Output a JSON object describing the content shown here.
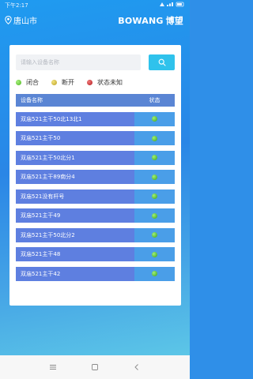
{
  "status_bar": {
    "time": "下午2:17"
  },
  "header": {
    "city": "唐山市",
    "brand_en": "BOWANG",
    "brand_cn": "博望"
  },
  "search": {
    "placeholder": "请输入设备名称"
  },
  "legend": [
    {
      "label": "闭合",
      "color": "#5fcf2e"
    },
    {
      "label": "断开",
      "color": "#d6c23a"
    },
    {
      "label": "状态未知",
      "color": "#c9232a"
    }
  ],
  "table": {
    "headers": {
      "name": "设备名称",
      "status": "状态"
    },
    "rows": [
      {
        "name": "双庙521主干50北13北1",
        "status": "闭合"
      },
      {
        "name": "双庙521主干50",
        "status": "闭合"
      },
      {
        "name": "双庙521主干50北分1",
        "status": "闭合"
      },
      {
        "name": "双庙521主干89南分4",
        "status": "闭合"
      },
      {
        "name": "双庙521没有杆号",
        "status": "闭合"
      },
      {
        "name": "双庙521主干49",
        "status": "闭合"
      },
      {
        "name": "双庙521主干50北分2",
        "status": "闭合"
      },
      {
        "name": "双庙521主干48",
        "status": "闭合"
      },
      {
        "name": "双庙521主干42",
        "status": "闭合"
      }
    ]
  },
  "colors": {
    "accent": "#2fc2ec",
    "table_header": "#5a85d4",
    "row": "#5e7fe0",
    "status_cell": "#4a9ee8"
  },
  "icons": {
    "location": "location-pin-icon",
    "search": "search-icon",
    "nav": [
      "menu-icon",
      "home-icon",
      "back-icon"
    ]
  }
}
